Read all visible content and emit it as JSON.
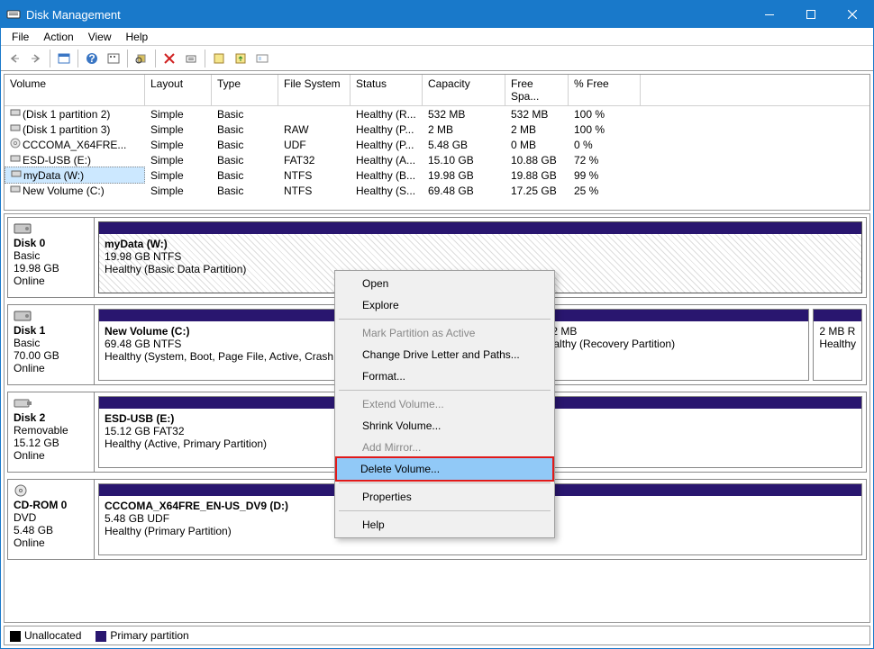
{
  "window": {
    "title": "Disk Management"
  },
  "menu": {
    "items": [
      "File",
      "Action",
      "View",
      "Help"
    ]
  },
  "columns": {
    "volume": "Volume",
    "layout": "Layout",
    "type": "Type",
    "fs": "File System",
    "status": "Status",
    "capacity": "Capacity",
    "free": "Free Spa...",
    "pct": "% Free"
  },
  "volumes": [
    {
      "icon": "part",
      "name": "(Disk 1 partition 2)",
      "layout": "Simple",
      "type": "Basic",
      "fs": "",
      "status": "Healthy (R...",
      "capacity": "532 MB",
      "free": "532 MB",
      "pct": "100 %"
    },
    {
      "icon": "part",
      "name": "(Disk 1 partition 3)",
      "layout": "Simple",
      "type": "Basic",
      "fs": "RAW",
      "status": "Healthy (P...",
      "capacity": "2 MB",
      "free": "2 MB",
      "pct": "100 %"
    },
    {
      "icon": "dvd",
      "name": "CCCOMA_X64FRE...",
      "layout": "Simple",
      "type": "Basic",
      "fs": "UDF",
      "status": "Healthy (P...",
      "capacity": "5.48 GB",
      "free": "0 MB",
      "pct": "0 %"
    },
    {
      "icon": "part",
      "name": "ESD-USB (E:)",
      "layout": "Simple",
      "type": "Basic",
      "fs": "FAT32",
      "status": "Healthy (A...",
      "capacity": "15.10 GB",
      "free": "10.88 GB",
      "pct": "72 %"
    },
    {
      "icon": "part",
      "name": "myData (W:)",
      "layout": "Simple",
      "type": "Basic",
      "fs": "NTFS",
      "status": "Healthy (B...",
      "capacity": "19.98 GB",
      "free": "19.88 GB",
      "pct": "99 %",
      "selected": true
    },
    {
      "icon": "part",
      "name": "New Volume (C:)",
      "layout": "Simple",
      "type": "Basic",
      "fs": "NTFS",
      "status": "Healthy (S...",
      "capacity": "69.48 GB",
      "free": "17.25 GB",
      "pct": "25 %"
    }
  ],
  "disks": [
    {
      "label": "Disk 0",
      "type": "Basic",
      "size": "19.98 GB",
      "status": "Online",
      "icon": "hdd",
      "parts": [
        {
          "title": "myData  (W:)",
          "line2": "19.98 GB NTFS",
          "line3": "Healthy (Basic Data Partition)",
          "flex": 1,
          "hatched": true
        }
      ]
    },
    {
      "label": "Disk 1",
      "type": "Basic",
      "size": "70.00 GB",
      "status": "Online",
      "icon": "hdd",
      "parts": [
        {
          "title": "New Volume  (C:)",
          "line2": "69.48 GB NTFS",
          "line3": "Healthy (System, Boot, Page File, Active, Crash",
          "flex": 58
        },
        {
          "title": "",
          "line2": "532 MB",
          "line3": "Healthy (Recovery Partition)",
          "flex": 37
        },
        {
          "title": "",
          "line2": "2 MB R",
          "line3": "Healthy",
          "flex": 5
        }
      ]
    },
    {
      "label": "Disk 2",
      "type": "Removable",
      "size": "15.12 GB",
      "status": "Online",
      "icon": "usb",
      "parts": [
        {
          "title": "ESD-USB  (E:)",
          "line2": "15.12 GB FAT32",
          "line3": "Healthy (Active, Primary Partition)",
          "flex": 1
        }
      ]
    },
    {
      "label": "CD-ROM 0",
      "type": "DVD",
      "size": "5.48 GB",
      "status": "Online",
      "icon": "dvd",
      "parts": [
        {
          "title": "CCCOMA_X64FRE_EN-US_DV9  (D:)",
          "line2": "5.48 GB UDF",
          "line3": "Healthy (Primary Partition)",
          "flex": 1
        }
      ]
    }
  ],
  "legend": {
    "unallocated": "Unallocated",
    "primary": "Primary partition"
  },
  "context": {
    "items": [
      {
        "label": "Open"
      },
      {
        "label": "Explore"
      },
      {
        "sep": true
      },
      {
        "label": "Mark Partition as Active",
        "disabled": true
      },
      {
        "label": "Change Drive Letter and Paths..."
      },
      {
        "label": "Format..."
      },
      {
        "sep": true
      },
      {
        "label": "Extend Volume...",
        "disabled": true
      },
      {
        "label": "Shrink Volume..."
      },
      {
        "label": "Add Mirror...",
        "disabled": true
      },
      {
        "label": "Delete Volume...",
        "highlight": true
      },
      {
        "sep": true
      },
      {
        "label": "Properties"
      },
      {
        "sep": true
      },
      {
        "label": "Help"
      }
    ]
  }
}
